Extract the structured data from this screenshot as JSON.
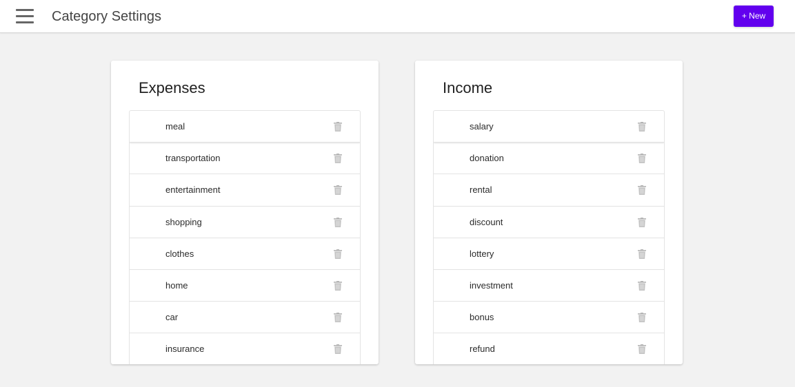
{
  "header": {
    "title": "Category Settings",
    "new_button_label": "+ New",
    "accent_color": "#6200ee"
  },
  "expenses": {
    "title": "Expenses",
    "items": [
      {
        "label": "meal"
      },
      {
        "label": "transportation"
      },
      {
        "label": "entertainment"
      },
      {
        "label": "shopping"
      },
      {
        "label": "clothes"
      },
      {
        "label": "home"
      },
      {
        "label": "car"
      },
      {
        "label": "insurance"
      }
    ]
  },
  "income": {
    "title": "Income",
    "items": [
      {
        "label": "salary"
      },
      {
        "label": "donation"
      },
      {
        "label": "rental"
      },
      {
        "label": "discount"
      },
      {
        "label": "lottery"
      },
      {
        "label": "investment"
      },
      {
        "label": "bonus"
      },
      {
        "label": "refund"
      }
    ]
  },
  "icons": {
    "menu": "hamburger-menu-icon",
    "delete": "trash-icon"
  }
}
